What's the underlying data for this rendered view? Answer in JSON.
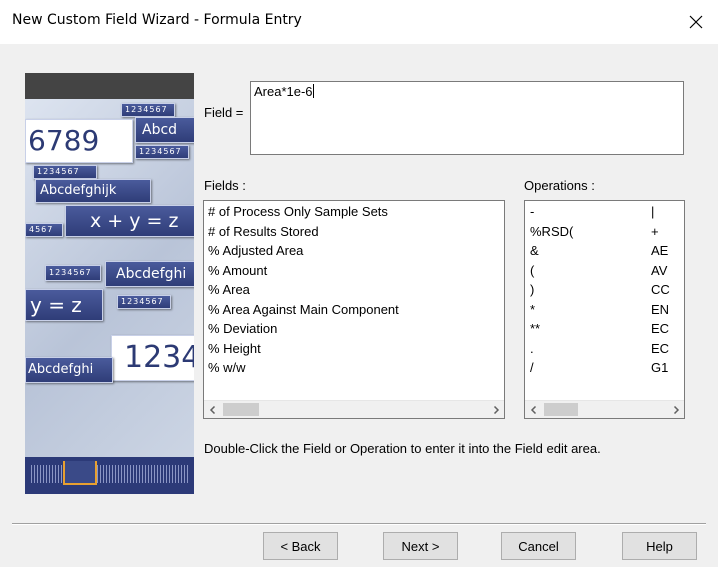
{
  "window": {
    "title": "New Custom Field Wizard - Formula Entry"
  },
  "field": {
    "label": "Field =",
    "value": "Area*1e-6"
  },
  "fields_list": {
    "label": "Fields :",
    "items": [
      "# of Process Only Sample Sets",
      "# of Results Stored",
      "% Adjusted Area",
      "% Amount",
      "% Area",
      "% Area Against Main Component",
      "% Deviation",
      "% Height",
      "% w/w"
    ]
  },
  "operations_list": {
    "label": "Operations :",
    "col1": [
      "-",
      "%RSD(",
      "&",
      "(",
      ")",
      "*",
      "**",
      ".",
      "/"
    ],
    "col2": [
      "|",
      "+",
      "AE",
      "AV",
      "CC",
      "EN",
      "EC",
      "EC",
      "G1"
    ]
  },
  "hint": "Double-Click the Field or Operation to enter it into the Field edit area.",
  "buttons": {
    "back": "< Back",
    "next": "Next >",
    "cancel": "Cancel",
    "help": "Help"
  },
  "side_image": {
    "t1": "1234567",
    "t2": "6789",
    "t3": "Abcd",
    "t4": "1234567",
    "t5": "1234567",
    "t6": "Abcdefghijk",
    "t7": "x + y = z",
    "t8": "4567",
    "t9": "1234567",
    "t10": "Abcdefghi",
    "t11": "y = z",
    "t12": "1234567",
    "t13": "1234",
    "t14": "Abcdefghi"
  }
}
